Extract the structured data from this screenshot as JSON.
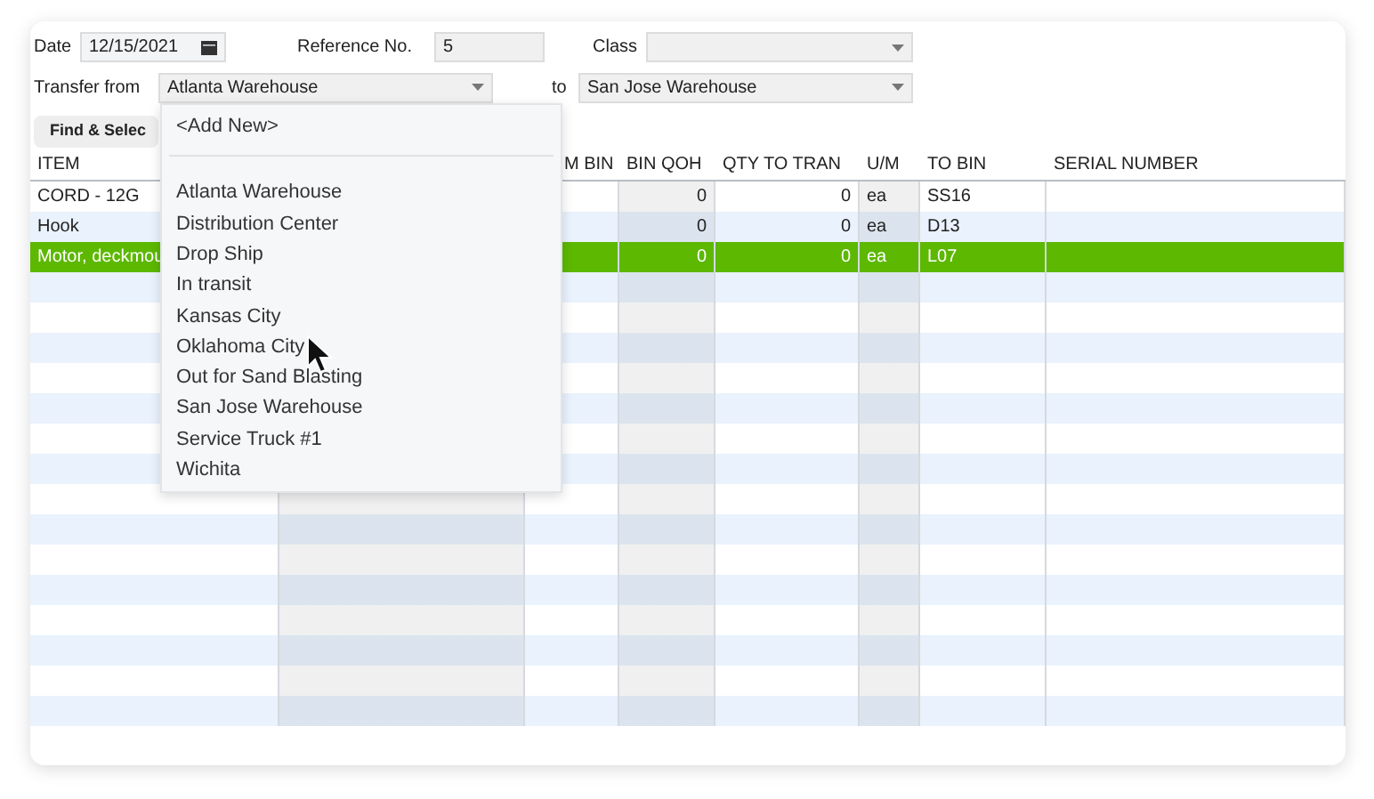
{
  "form": {
    "date_label": "Date",
    "date_value": "12/15/2021",
    "reference_label": "Reference No.",
    "reference_value": "5",
    "class_label": "Class",
    "transfer_from_label": "Transfer from",
    "transfer_from_value": "Atlanta Warehouse",
    "to_label": "to",
    "to_value": "San Jose Warehouse",
    "find_button": "Find & Selec"
  },
  "dropdown": {
    "add_new": "<Add New>",
    "items": [
      {
        "label": "Atlanta Warehouse"
      },
      {
        "label": "Distribution Center"
      },
      {
        "label": "Drop Ship"
      },
      {
        "label": "In transit"
      },
      {
        "label": "Kansas City"
      },
      {
        "label": "Oklahoma City"
      },
      {
        "label": "Out for Sand Blasting"
      },
      {
        "label": "San Jose Warehouse"
      },
      {
        "label": "Service Truck #1"
      },
      {
        "label": "Wichita"
      }
    ]
  },
  "table": {
    "columns": [
      "ITEM",
      "",
      "M BIN",
      "BIN QOH",
      "QTY TO TRAN",
      "U/M",
      "TO BIN",
      "SERIAL NUMBER"
    ],
    "rows": [
      {
        "item": "CORD - 12G",
        "bin_qoh": "0",
        "qty": "0",
        "um": "ea",
        "to_bin": "SS16",
        "selected": false
      },
      {
        "item": "Hook",
        "bin_qoh": "0",
        "qty": "0",
        "um": "ea",
        "to_bin": "D13",
        "selected": false
      },
      {
        "item": "Motor, deckmou",
        "bin_qoh": "0",
        "qty": "0",
        "um": "ea",
        "to_bin": "L07",
        "selected": true
      }
    ]
  }
}
